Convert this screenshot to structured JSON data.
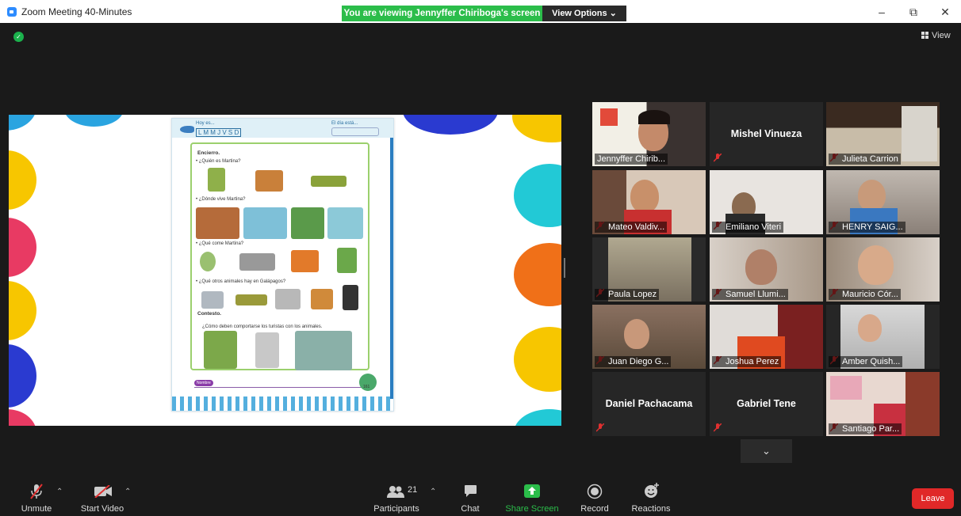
{
  "window": {
    "title": "Zoom Meeting 40-Minutes",
    "viewing_banner": "You are viewing Jennyffer Chiriboga's screen",
    "view_options": "View Options ⌄",
    "minimize": "–",
    "restore": "⧉",
    "close": "✕"
  },
  "header": {
    "view_label": "View"
  },
  "shared_page": {
    "hoy_es": "Hoy es...",
    "days": "L M M J V S D",
    "dia_esta": "El día está...",
    "section1": "Encierro.",
    "q1": "• ¿Quién es Martina?",
    "q2": "• ¿Dónde vive Martina?",
    "q3": "• ¿Qué come Martina?",
    "q4": "• ¿Qué otros animales hay en Galápagos?",
    "section2": "Contesto.",
    "q5": "¿Cómo deben comportarse los turistas con los animales.",
    "nombre": "Nombre",
    "page_number": "161"
  },
  "participants_grid": [
    {
      "name": "Jennyffer Chirib...",
      "type": "video",
      "muted": false,
      "active": true
    },
    {
      "name": "Mishel Vinueza",
      "type": "name",
      "muted": true
    },
    {
      "name": "Julieta Carrion",
      "type": "video",
      "muted": true
    },
    {
      "name": "Mateo Valdiv...",
      "type": "video",
      "muted": true
    },
    {
      "name": "Emiliano Viteri",
      "type": "video",
      "muted": true
    },
    {
      "name": "HENRY SAIG...",
      "type": "video",
      "muted": true
    },
    {
      "name": "Paula Lopez",
      "type": "video",
      "muted": true
    },
    {
      "name": "Samuel Llumi...",
      "type": "video",
      "muted": true
    },
    {
      "name": "Mauricio Cór...",
      "type": "video",
      "muted": true
    },
    {
      "name": "Juan Diego G...",
      "type": "video",
      "muted": true
    },
    {
      "name": "Joshua Perez",
      "type": "video",
      "muted": true
    },
    {
      "name": "Amber Quish...",
      "type": "video",
      "muted": true
    },
    {
      "name": "Daniel Pachacama",
      "type": "name",
      "muted": true
    },
    {
      "name": "Gabriel Tene",
      "type": "name",
      "muted": true
    },
    {
      "name": "Santiago Par...",
      "type": "video",
      "muted": true
    }
  ],
  "toolbar": {
    "unmute": "Unmute",
    "start_video": "Start Video",
    "participants": "Participants",
    "participants_count": "21",
    "chat": "Chat",
    "share_screen": "Share Screen",
    "record": "Record",
    "reactions": "Reactions",
    "leave": "Leave"
  },
  "colors": {
    "share_green": "#2bbd4a",
    "leave_red": "#e02828",
    "active_speaker": "#d6e04a"
  }
}
